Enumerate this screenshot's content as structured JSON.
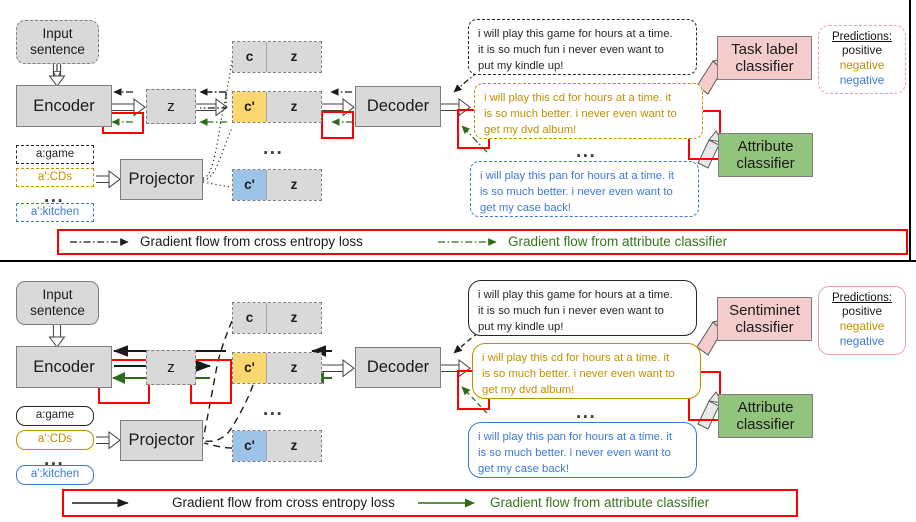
{
  "figure": {
    "title": "Attribute-conditioned text generation model diagram (two variants)",
    "colors": {
      "grey_node": "#d9d9d9",
      "yellow_cell": "#fbd770",
      "blue_cell": "#9dc3e6",
      "pink_classifier": "#f4cccc",
      "green_classifier": "#93c47d",
      "red_highlight": "#ff0000",
      "gold_text": "#bf9000",
      "blue_text": "#3c78d8",
      "green_text": "#38761d"
    }
  },
  "top": {
    "input_box": "Input\nsentence",
    "input_line1": "Input",
    "input_line2": "sentence",
    "encoder": "Encoder",
    "latent_z": "z",
    "projector": "Projector",
    "decoder": "Decoder",
    "attributes": [
      {
        "label": "a:game",
        "color": "#262626"
      },
      {
        "label": "a':CDs",
        "color": "#bf9000"
      },
      {
        "label": "a':kitchen",
        "color": "#3c78d8"
      }
    ],
    "attribute_ellipsis": "...",
    "cz_rows": [
      {
        "c": "c",
        "z": "z",
        "c_color": "#d9d9d9"
      },
      {
        "c": "c'",
        "z": "z",
        "c_color": "#fbd770"
      },
      {
        "c": "c'",
        "z": "z",
        "c_color": "#9dc3e6"
      }
    ],
    "cz_ellipsis": "...",
    "sentences": [
      {
        "text": "i will play this game for hours at a time. it is so much fun i never even want to put my kindle up!",
        "line1": "i will play this game for hours at a time.",
        "line2": "it is so much fun i never even want to",
        "line3": "put my kindle up!",
        "color": "#262626"
      },
      {
        "text": "i will play this cd for hours at a time. it is so much better. i never even want to get my dvd album!",
        "line1": "i will play this cd for hours at a time. it",
        "line2": "is so much better. i never even want to",
        "line3": "get my dvd album!",
        "color": "#bf9000"
      },
      {
        "text": "i will play this pan for hours at a time. it is so much better. i never even want to get my case back!",
        "line1": "i will play this pan for hours at a time. it",
        "line2": "is so much better. i never even want to",
        "line3": "get my case back!",
        "color": "#3c78d8"
      }
    ],
    "sentence_ellipsis": "...",
    "task_classifier_line1": "Task label",
    "task_classifier_line2": "classifier",
    "attribute_classifier_line1": "Attribute",
    "attribute_classifier_line2": "classifier",
    "predictions": {
      "header": "Predictions:",
      "values": [
        "positive",
        "negative",
        "negative"
      ]
    },
    "legend": {
      "cross_entropy": "Gradient flow from cross entropy loss",
      "attribute": "Gradient flow from attribute classifier"
    }
  },
  "bottom": {
    "input_line1": "Input",
    "input_line2": "sentence",
    "encoder": "Encoder",
    "latent_z": "z",
    "projector": "Projector",
    "decoder": "Decoder",
    "attributes": [
      {
        "label": "a:game",
        "color": "#262626"
      },
      {
        "label": "a':CDs",
        "color": "#bf9000"
      },
      {
        "label": "a':kitchen",
        "color": "#3c78d8"
      }
    ],
    "attribute_ellipsis": "...",
    "cz_rows": [
      {
        "c": "c",
        "z": "z",
        "c_color": "#d9d9d9"
      },
      {
        "c": "c'",
        "z": "z",
        "c_color": "#fbd770"
      },
      {
        "c": "c'",
        "z": "z",
        "c_color": "#9dc3e6"
      }
    ],
    "cz_ellipsis": "...",
    "sentences": [
      {
        "line1": "i will play this game for hours at a time.",
        "line2": "it is so much fun i never even want to",
        "line3": "put my kindle up!",
        "color": "#262626"
      },
      {
        "line1": "i will play this cd for hours at a time. it",
        "line2": "is so much better. i never even want to",
        "line3": "get my dvd album!",
        "color": "#bf9000"
      },
      {
        "line1": "i will play this pan for hours at a time. it",
        "line2": "is so much better. i never even want to",
        "line3": "get my case back!",
        "color": "#3c78d8"
      }
    ],
    "sentence_ellipsis": "...",
    "sentiment_classifier_line1": "Sentiminet",
    "sentiment_classifier_line2": "classifier",
    "attribute_classifier_line1": "Attribute",
    "attribute_classifier_line2": "classifier",
    "predictions": {
      "header": "Predictions:",
      "values": [
        "positive",
        "negative",
        "negative"
      ]
    },
    "legend": {
      "cross_entropy": "Gradient flow from cross entropy loss",
      "attribute": "Gradient flow from attribute classifier"
    }
  }
}
